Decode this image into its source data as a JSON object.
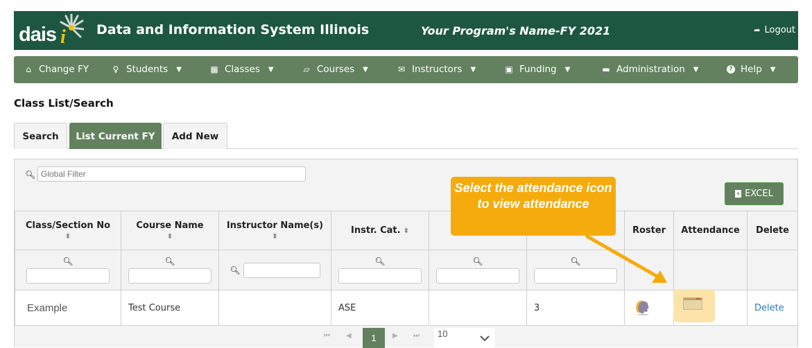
{
  "header": {
    "logo_text": "dais",
    "logo_i": "i",
    "site_title": "Data and Information System Illinois",
    "program_name": "Your Program's Name-FY 2021",
    "logout_label": "Logout",
    "logout_icon": "➦",
    "colors": {
      "header_bg": "#1e5741",
      "nav_bg": "#63815f",
      "accent_yellow": "#f2c20d"
    }
  },
  "nav": {
    "items": [
      {
        "label": "Change FY",
        "icon": "⌂",
        "has_caret": false
      },
      {
        "label": "Students",
        "icon": "♀",
        "has_caret": true
      },
      {
        "label": "Classes",
        "icon": "▦",
        "has_caret": true
      },
      {
        "label": "Courses",
        "icon": "▱",
        "has_caret": true
      },
      {
        "label": "Instructors",
        "icon": "✉",
        "has_caret": true
      },
      {
        "label": "Funding",
        "icon": "▣",
        "has_caret": true
      },
      {
        "label": "Administration",
        "icon": "▬",
        "has_caret": true
      },
      {
        "label": "Help",
        "icon": "?",
        "has_caret": true
      }
    ],
    "caret": "▼"
  },
  "page": {
    "title": "Class List/Search",
    "tabs": [
      {
        "label": "Search",
        "active": false
      },
      {
        "label": "List Current FY",
        "active": true
      },
      {
        "label": "Add New",
        "active": false
      }
    ]
  },
  "table": {
    "global_filter_placeholder": "Global Filter",
    "search_icon": "🔍",
    "excel_label": "EXCEL",
    "excel_icon_glyph": "x",
    "sort_icon": "⬍",
    "columns": [
      {
        "label": "Class/Section No",
        "sortable": true,
        "filter": true
      },
      {
        "label": "Course Name",
        "sortable": true,
        "filter": true
      },
      {
        "label": "Instructor Name(s)",
        "sortable": true,
        "filter": true
      },
      {
        "label": "Instr. Cat.",
        "sortable": true,
        "filter": true
      },
      {
        "label": "",
        "sortable": false,
        "filter": true
      },
      {
        "label": "",
        "sortable": false,
        "filter": true
      },
      {
        "label": "Roster",
        "sortable": false,
        "filter": false
      },
      {
        "label": "Attendance",
        "sortable": false,
        "filter": false
      },
      {
        "label": "Delete",
        "sortable": false,
        "filter": false
      }
    ],
    "rows": [
      {
        "class_section_no": "Example",
        "course_name": "Test Course",
        "instructor_names": "",
        "instr_cat": "ASE",
        "col5": "",
        "col6": "3",
        "roster_icon": "roster-person-icon",
        "attendance_icon": "attendance-calendar-icon",
        "delete_label": "Delete"
      }
    ],
    "pagination": {
      "first": "⏮",
      "prev": "◀",
      "current_page": "1",
      "next": "▶",
      "last": "⏭",
      "per_page": "10",
      "per_page_chevron": "⌄"
    }
  },
  "callout": {
    "text": "Select the attendance icon to view attendance",
    "color": "#f6ab0d"
  }
}
